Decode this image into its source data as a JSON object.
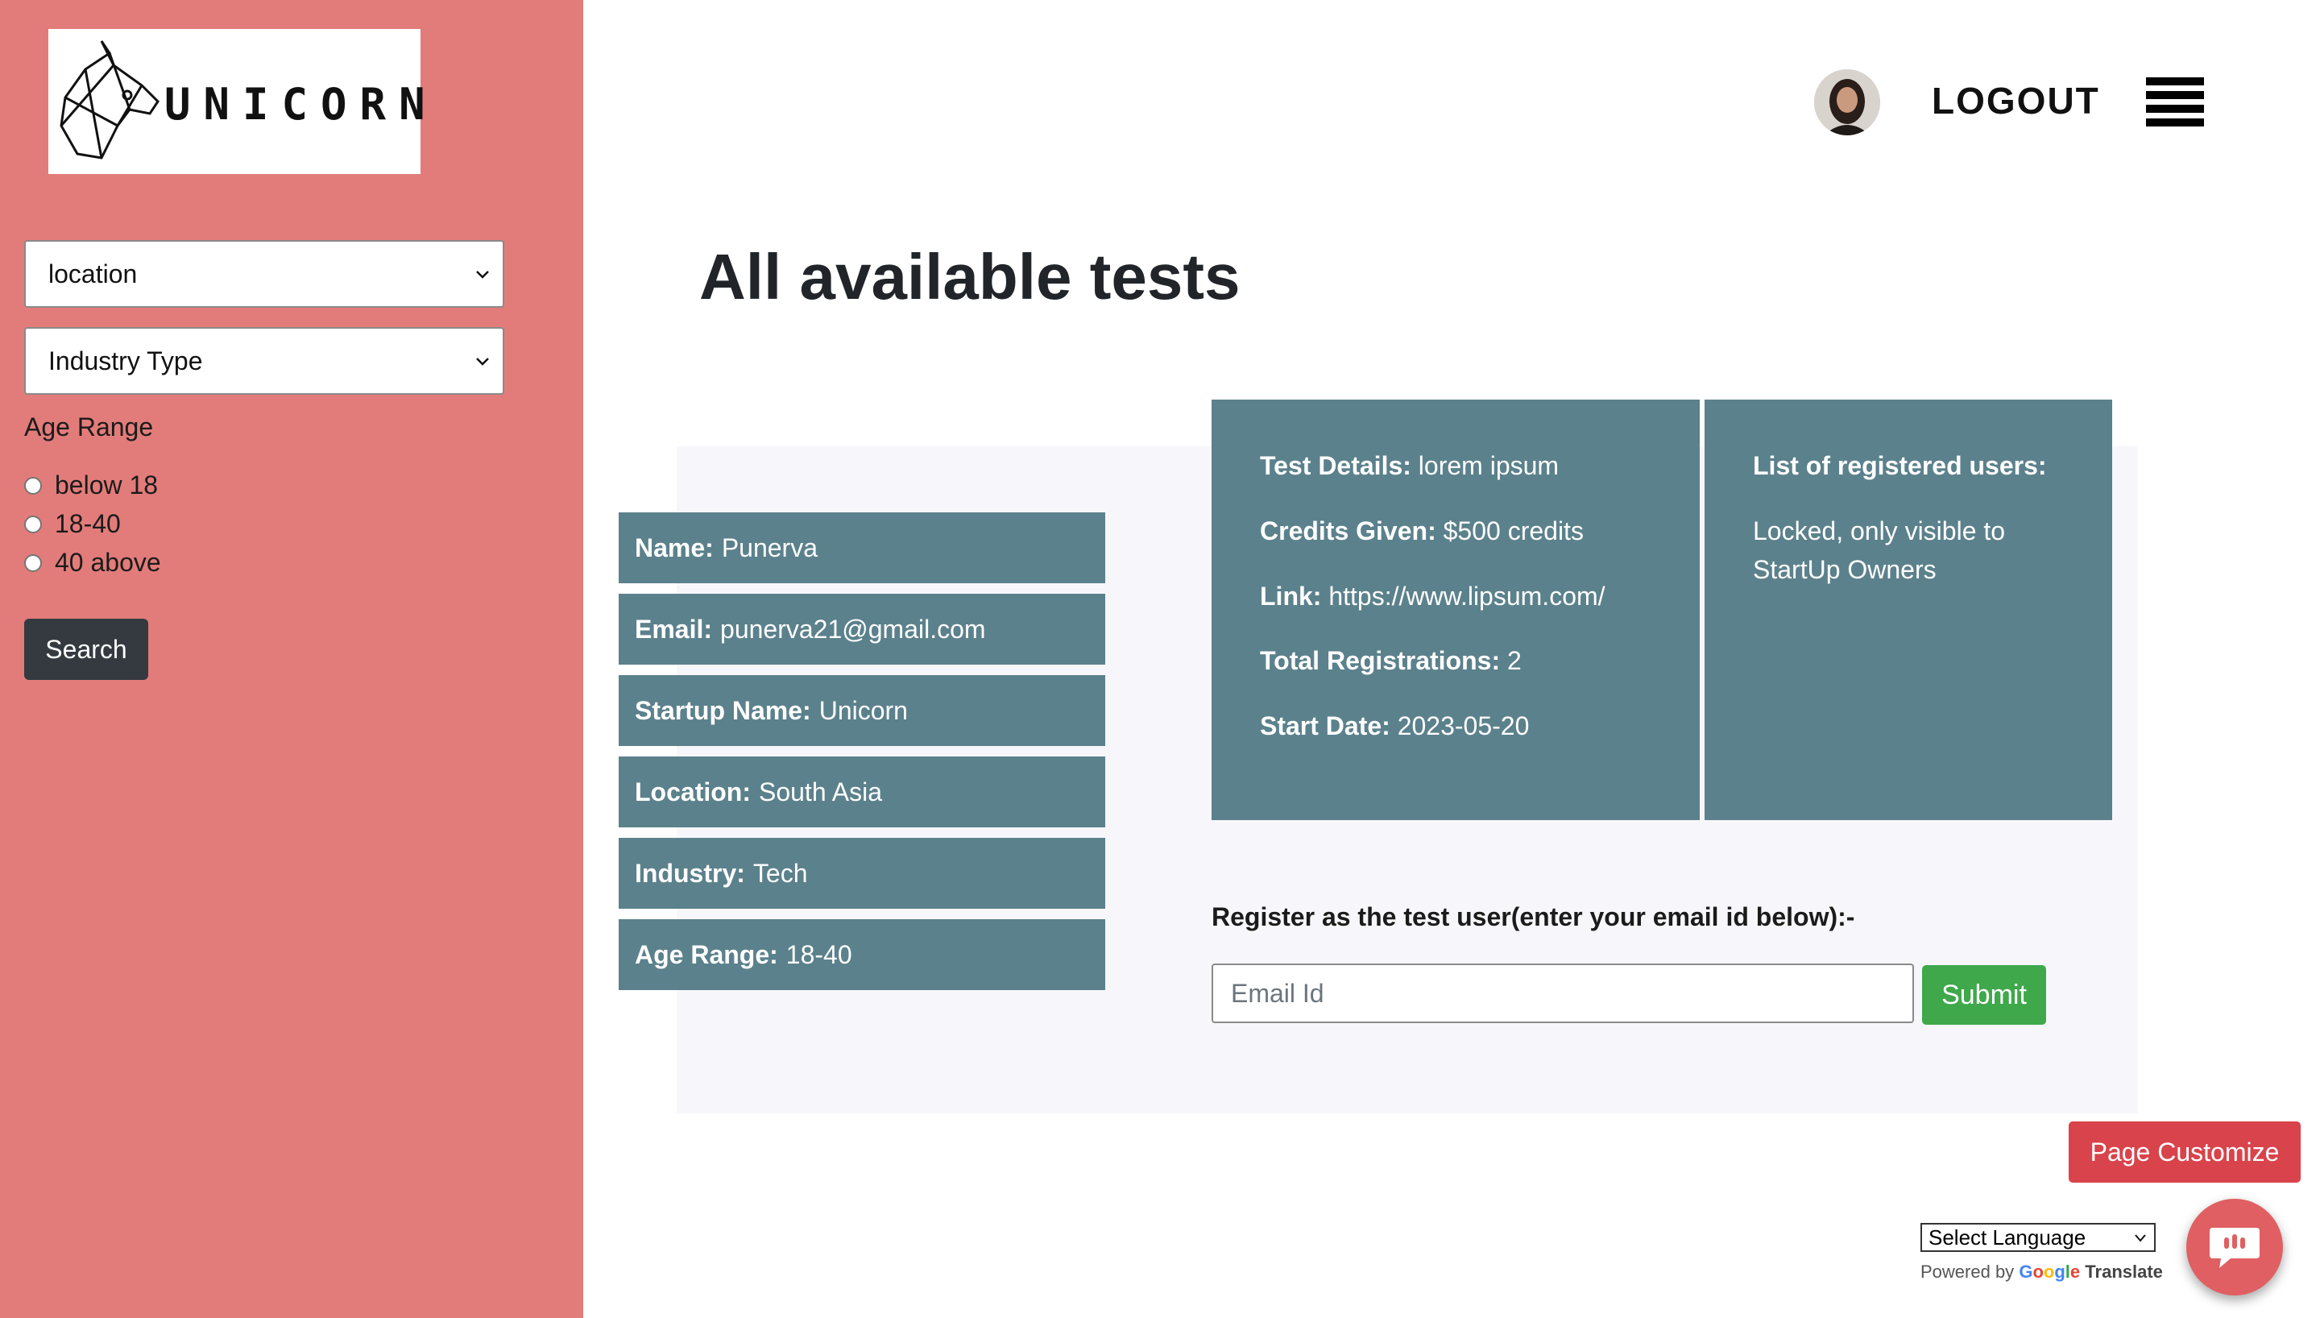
{
  "brand": {
    "logo_text": "UNICORN"
  },
  "filters": {
    "location_label": "location",
    "industry_label": "Industry Type",
    "age_range_title": "Age Range",
    "age_options": [
      "below 18",
      "18-40",
      "40 above"
    ],
    "search_label": "Search"
  },
  "header": {
    "logout_label": "LOGOUT"
  },
  "page": {
    "title": "All available tests"
  },
  "profile": [
    {
      "key": "Name:",
      "value": "Punerva"
    },
    {
      "key": "Email:",
      "value": "punerva21@gmail.com"
    },
    {
      "key": "Startup Name:",
      "value": "Unicorn"
    },
    {
      "key": "Location:",
      "value": "South Asia"
    },
    {
      "key": "Industry:",
      "value": "Tech"
    },
    {
      "key": "Age Range:",
      "value": "18-40"
    }
  ],
  "test_details": [
    {
      "key": "Test Details:",
      "value": "lorem ipsum"
    },
    {
      "key": "Credits Given:",
      "value": "$500 credits"
    },
    {
      "key": "Link:",
      "value": "https://www.lipsum.com/"
    },
    {
      "key": "Total Registrations:",
      "value": "2"
    },
    {
      "key": "Start Date:",
      "value": "2023-05-20"
    }
  ],
  "registered_users": {
    "title": "List of registered users:",
    "line1": "Locked, only visible to",
    "line2": "StartUp Owners"
  },
  "register": {
    "label": "Register as the test user(enter your email id below):-",
    "email_placeholder": "Email Id",
    "submit_label": "Submit"
  },
  "page_customize_label": "Page Customize",
  "translate": {
    "select_label": "Select Language",
    "powered_by": "Powered by",
    "google": "Google",
    "translate": "Translate"
  },
  "colors": {
    "sidebar": "#e27c7a",
    "card": "#5b818c",
    "submit": "#3fa84b",
    "customize": "#d9434b"
  }
}
